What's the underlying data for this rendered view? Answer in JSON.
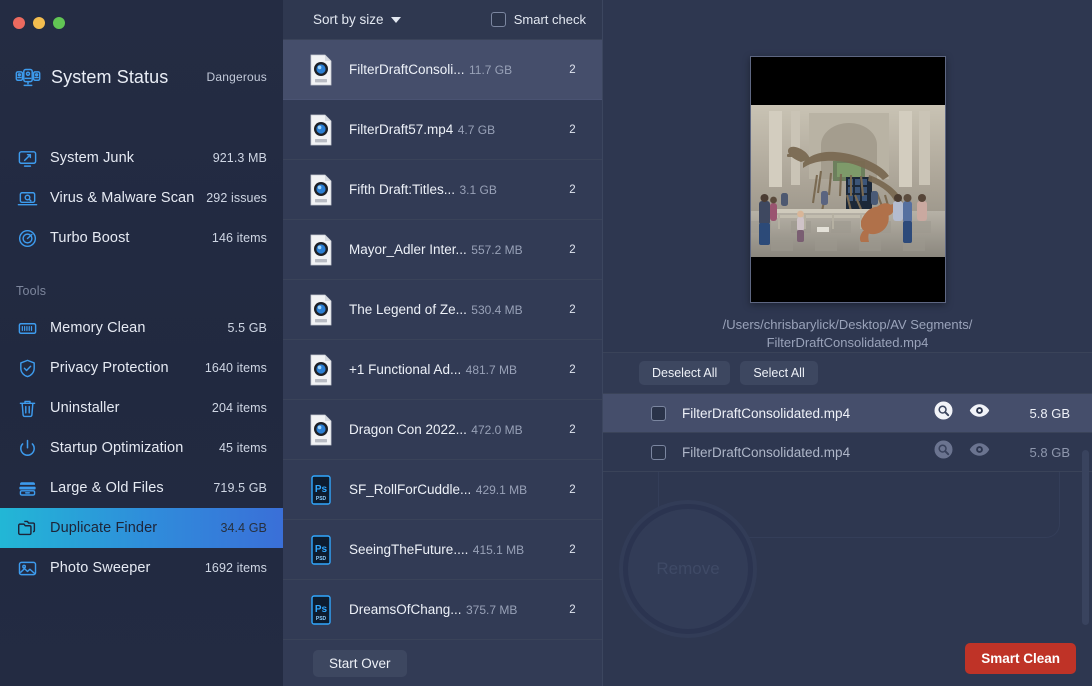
{
  "window": {
    "traffic_lights": [
      "close",
      "minimize",
      "zoom"
    ]
  },
  "sidebar": {
    "status": {
      "icon": "system-status-icon",
      "title": "System Status",
      "value": "Dangerous"
    },
    "items": [
      {
        "icon": "system-junk-icon",
        "label": "System Junk",
        "meta": "921.3 MB"
      },
      {
        "icon": "virus-scan-icon",
        "label": "Virus & Malware Scan",
        "meta": "292 issues"
      },
      {
        "icon": "turbo-boost-icon",
        "label": "Turbo Boost",
        "meta": "146 items"
      }
    ],
    "section_label": "Tools",
    "tools": [
      {
        "icon": "memory-clean-icon",
        "label": "Memory Clean",
        "meta": "5.5 GB",
        "active": false
      },
      {
        "icon": "privacy-protection-icon",
        "label": "Privacy Protection",
        "meta": "1640 items",
        "active": false
      },
      {
        "icon": "uninstaller-icon",
        "label": "Uninstaller",
        "meta": "204 items",
        "active": false
      },
      {
        "icon": "startup-optimization-icon",
        "label": "Startup Optimization",
        "meta": "45 items",
        "active": false
      },
      {
        "icon": "large-old-files-icon",
        "label": "Large & Old Files",
        "meta": "719.5 GB",
        "active": false
      },
      {
        "icon": "duplicate-finder-icon",
        "label": "Duplicate Finder",
        "meta": "34.4 GB",
        "active": true
      },
      {
        "icon": "photo-sweeper-icon",
        "label": "Photo Sweeper",
        "meta": "1692 items",
        "active": false
      }
    ]
  },
  "list_panel": {
    "sort_label": "Sort by size",
    "smart_check_label": "Smart check",
    "smart_check_value": false,
    "start_over_label": "Start Over",
    "rows": [
      {
        "kind": "mp4",
        "name": "FilterDraftConsoli...",
        "size": "11.7 GB",
        "count": "2",
        "selected": true
      },
      {
        "kind": "mp4",
        "name": "FilterDraft57.mp4",
        "size": "4.7 GB",
        "count": "2",
        "selected": false
      },
      {
        "kind": "mov",
        "name": "Fifth Draft:Titles...",
        "size": "3.1 GB",
        "count": "2",
        "selected": false
      },
      {
        "kind": "mov",
        "name": "Mayor_Adler Inter...",
        "size": "557.2 MB",
        "count": "2",
        "selected": false
      },
      {
        "kind": "mov",
        "name": "The Legend of Ze...",
        "size": "530.4 MB",
        "count": "2",
        "selected": false
      },
      {
        "kind": "mov",
        "name": "+1 Functional Ad...",
        "size": "481.7 MB",
        "count": "2",
        "selected": false
      },
      {
        "kind": "mp4",
        "name": "Dragon Con 2022...",
        "size": "472.0 MB",
        "count": "2",
        "selected": false
      },
      {
        "kind": "psd",
        "name": "SF_RollForCuddle...",
        "size": "429.1 MB",
        "count": "2",
        "selected": false
      },
      {
        "kind": "psd",
        "name": "SeeingTheFuture....",
        "size": "415.1 MB",
        "count": "2",
        "selected": false
      },
      {
        "kind": "psd",
        "name": "DreamsOfChang...",
        "size": "375.7 MB",
        "count": "2",
        "selected": false
      }
    ]
  },
  "detail": {
    "preview_caption_line1": "/Users/chrisbarylick/Desktop/AV Segments/",
    "preview_caption_line2": "FilterDraftConsolidated.mp4",
    "deselect_all_label": "Deselect All",
    "select_all_label": "Select All",
    "duplicates": [
      {
        "name": "FilterDraftConsolidated.mp4",
        "size": "5.8 GB",
        "checked": false,
        "highlighted": true
      },
      {
        "name": "FilterDraftConsolidated.mp4",
        "size": "5.8 GB",
        "checked": false,
        "highlighted": false
      }
    ],
    "remove_label": "Remove",
    "smart_clean_label": "Smart Clean"
  },
  "colors": {
    "sidebar_bg": "#222a40",
    "panel_bg": "#323b55",
    "detail_bg": "#2e3750",
    "accent_cyan": "#22b7d6",
    "accent_blue": "#3a6fd8",
    "danger_red": "#bf3327",
    "icon_blue": "#3d9bed",
    "selected_row": "#454e6b"
  }
}
